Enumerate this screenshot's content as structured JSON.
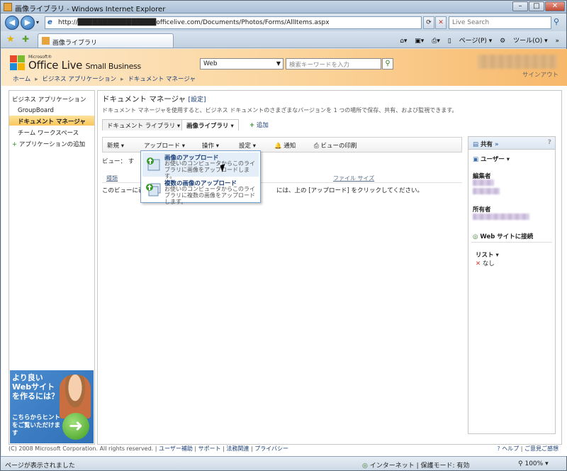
{
  "window": {
    "title": "画像ライブラリ - Windows Internet Explorer"
  },
  "browser": {
    "address": "http://████████████████officelive.com/Documents/Photos/Forms/AllItems.aspx",
    "search_placeholder": "Live Search",
    "tab_title": "画像ライブラリ",
    "tools": {
      "page": "ページ(P)",
      "tools": "ツール(O)"
    }
  },
  "header": {
    "logo_small": "Microsoft®",
    "logo_main": "Office Live",
    "logo_sub": "Small Business",
    "scope": "Web",
    "search_placeholder": "検索キーワードを入力",
    "signout": "サインアウト",
    "breadcrumb": [
      "ホーム",
      "ビジネス アプリケーション",
      "ドキュメント マネージャ"
    ]
  },
  "leftnav": {
    "items": [
      {
        "label": "ビジネス アプリケーション"
      },
      {
        "label": "GroupBoard"
      },
      {
        "label": "ドキュメント マネージャ"
      },
      {
        "label": "チーム ワークスペース"
      },
      {
        "label": "アプリケーションの追加"
      }
    ]
  },
  "ad": {
    "line1": "より良いWebサイトを作るには？",
    "line2": "こちらからヒントをご覧いただけます"
  },
  "main": {
    "title": "ドキュメント マネージャ",
    "settings": "[設定]",
    "description": "ドキュメント マネージャを使用すると、ビジネス ドキュメントのさまざまなバージョンを 1 つの場所で保存、共有、および監視できます。",
    "tabs": [
      "ドキュメント ライブラリ",
      "画像ライブラリ"
    ],
    "add_tab": "追加",
    "toolbar": {
      "new": "新規",
      "upload": "アップロード",
      "actions": "操作",
      "settings": "設定",
      "alert": "通知",
      "print": "ビューの印刷"
    },
    "view_label": "ビュー：",
    "view_value": "す",
    "columns": [
      "種類",
      "ファイル サイズ"
    ],
    "empty_text_1": "このビューに表",
    "empty_text_2": "には、上の [アップロード] をクリックしてください。"
  },
  "menu": {
    "items": [
      {
        "title": "画像のアップロード",
        "desc": "お使いのコンピュータからこのライブラリに画像をアップロードします。"
      },
      {
        "title": "複数の画像のアップロード",
        "desc": "お使いのコンピュータからこのライブラリに複数の画像をアップロードします。"
      }
    ]
  },
  "sidepanel": {
    "header": "共有",
    "chevron": "»",
    "help": "?",
    "users": "ユーザー",
    "editor": "編集者",
    "owner": "所有者",
    "connect": "Web サイトに接続",
    "list": "リスト",
    "none": "なし"
  },
  "footer": {
    "copyright": "(C) 2008 Microsoft Corporation. All rights reserved.",
    "links": [
      "ユーザー補助",
      "サポート",
      "法務関連",
      "プライバシー"
    ],
    "help": "ヘルプ",
    "feedback": "ご意見ご感想"
  },
  "status": {
    "text": "ページが表示されました",
    "zone": "インターネット | 保護モード: 有効",
    "zoom": "100%"
  }
}
